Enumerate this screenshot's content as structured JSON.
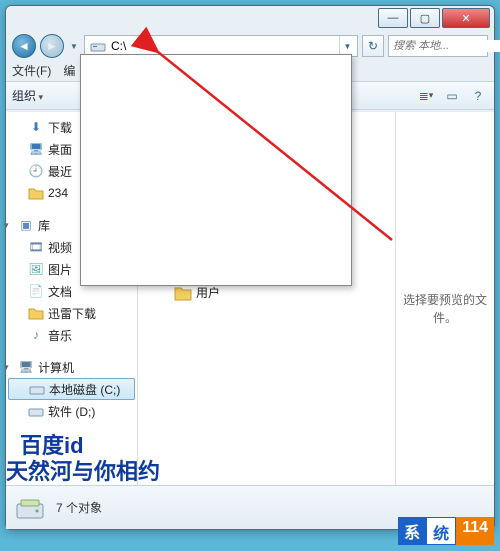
{
  "titlebar": {
    "min": "—",
    "max": "▢",
    "close": "✕"
  },
  "nav": {
    "back": "◄",
    "forward": "►",
    "menu": "▼",
    "refresh": "↻"
  },
  "address": {
    "value": "C:\\",
    "dropdown": "▼"
  },
  "search": {
    "placeholder": "搜索 本地..."
  },
  "menu": {
    "file": "文件(F)",
    "edit": "编"
  },
  "toolbar": {
    "organize": "组织",
    "views": "≣",
    "preview": "▭",
    "help": "?"
  },
  "sidebar": {
    "items": [
      {
        "icon": "⬇",
        "label": "下载",
        "type": "item"
      },
      {
        "icon": "🖥",
        "label": "桌面",
        "type": "item"
      },
      {
        "icon": "🕘",
        "label": "最近",
        "type": "item"
      },
      {
        "icon": "📁",
        "label": "234",
        "type": "item"
      }
    ],
    "libraries_label": "库",
    "libraries": [
      {
        "icon": "🎞",
        "label": "视频"
      },
      {
        "icon": "🖼",
        "label": "图片"
      },
      {
        "icon": "📄",
        "label": "文档"
      },
      {
        "icon": "📁",
        "label": "迅雷下载"
      },
      {
        "icon": "♪",
        "label": "音乐"
      }
    ],
    "computer_label": "计算机",
    "drives": [
      {
        "icon": "🖴",
        "label": "本地磁盘 (C;)",
        "sel": true
      },
      {
        "icon": "🖴",
        "label": "软件 (D;)"
      }
    ]
  },
  "content": {
    "folders": [
      {
        "label": "用户"
      }
    ]
  },
  "preview": {
    "text": "选择要预览的文件。"
  },
  "status": {
    "count": "7 个对象"
  },
  "watermark": {
    "line1": "百度id",
    "line2": "天然河与你相约",
    "logo_a": "系",
    "logo_b": "统",
    "logo_c": "114"
  }
}
